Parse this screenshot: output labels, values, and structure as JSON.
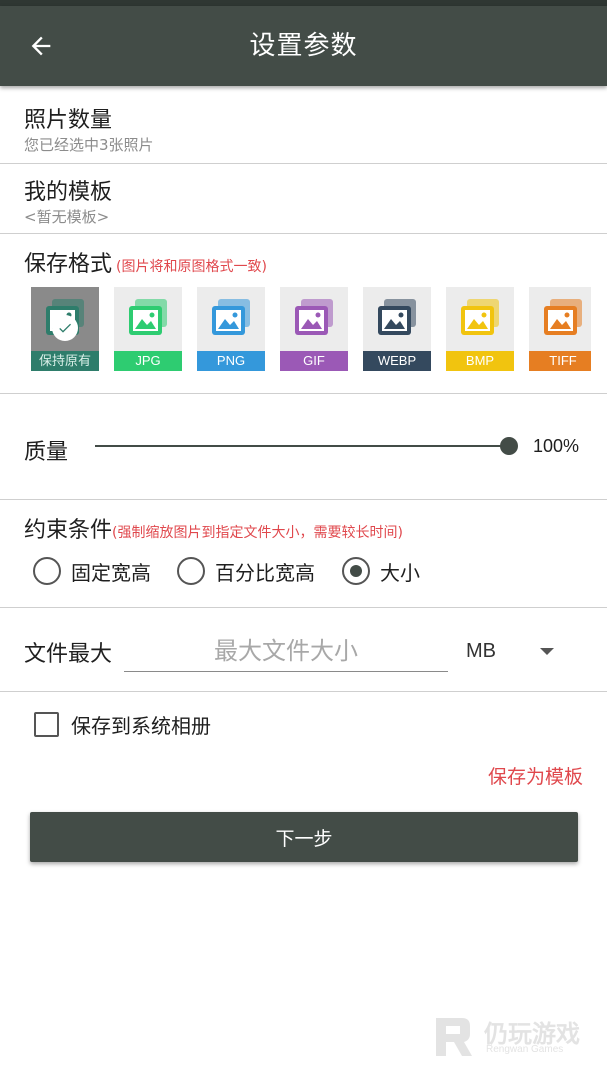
{
  "appbar": {
    "title": "设置参数"
  },
  "photo_count": {
    "title": "照片数量",
    "subtitle": "您已经选中3张照片"
  },
  "templates": {
    "title": "我的模板",
    "subtitle": "<暂无模板>"
  },
  "save_format": {
    "title": "保存格式",
    "note": "(图片将和原图格式一致)",
    "options": [
      {
        "label": "保持原有",
        "color": "#2e7d6b",
        "selected": true
      },
      {
        "label": "JPG",
        "color": "#2ecc71",
        "selected": false
      },
      {
        "label": "PNG",
        "color": "#3498db",
        "selected": false
      },
      {
        "label": "GIF",
        "color": "#9b59b6",
        "selected": false
      },
      {
        "label": "WEBP",
        "color": "#34495e",
        "selected": false
      },
      {
        "label": "BMP",
        "color": "#f1c40f",
        "selected": false
      },
      {
        "label": "TIFF",
        "color": "#e67e22",
        "selected": false
      }
    ]
  },
  "quality": {
    "label": "质量",
    "value_text": "100%",
    "value": 100
  },
  "constraint": {
    "title": "约束条件",
    "note": "(强制缩放图片到指定文件大小，需要较长时间)",
    "options": [
      {
        "label": "固定宽高",
        "selected": false
      },
      {
        "label": "百分比宽高",
        "selected": false
      },
      {
        "label": "大小",
        "selected": true
      }
    ]
  },
  "file_max": {
    "label": "文件最大",
    "placeholder": "最大文件大小",
    "value": "",
    "unit": "MB"
  },
  "save_album": {
    "label": "保存到系统相册",
    "checked": false
  },
  "save_template": {
    "label": "保存为模板"
  },
  "next": {
    "label": "下一步"
  },
  "watermark": {
    "text": "仍玩游戏",
    "sub": "Rengwan Games"
  }
}
